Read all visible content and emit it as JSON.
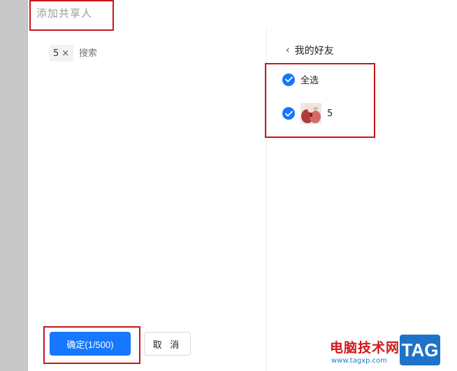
{
  "dialog": {
    "title": "添加共享人"
  },
  "left": {
    "selected_chip": {
      "label": "5",
      "remove_icon": "×"
    },
    "search": {
      "placeholder": "搜索",
      "value": ""
    }
  },
  "right": {
    "back_icon": "‹",
    "header": "我的好友",
    "select_all": {
      "label": "全选",
      "checked": true
    },
    "friends": [
      {
        "name": "5",
        "checked": true
      }
    ]
  },
  "footer": {
    "confirm_label": "确定(1/500)",
    "cancel_label": "取 消"
  },
  "watermark": {
    "text": "电脑技术网",
    "url": "www.tagxp.com",
    "badge": "TAG"
  },
  "colors": {
    "accent": "#1677ff",
    "highlight": "#c8161d"
  }
}
